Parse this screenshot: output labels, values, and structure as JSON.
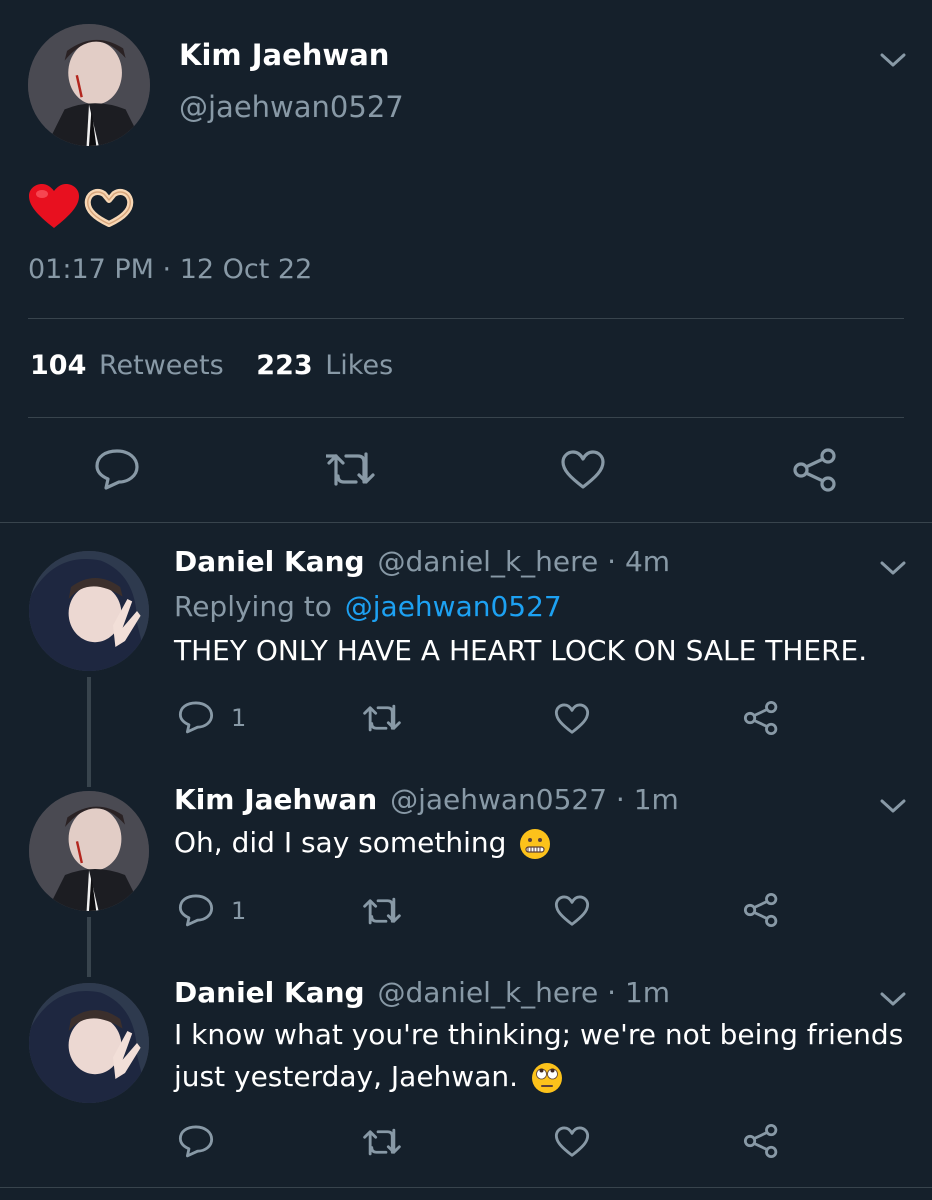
{
  "main_tweet": {
    "author_name": "Kim Jaehwan",
    "author_handle": "@jaehwan0527",
    "timestamp": "01:17 PM · 12 Oct 22",
    "stats": {
      "retweets_count": "104",
      "retweets_label": "Retweets",
      "likes_count": "223",
      "likes_label": "Likes"
    }
  },
  "replies": [
    {
      "author_name": "Daniel Kang",
      "meta": "@daniel_k_here · 4m",
      "replying_to_label": "Replying to",
      "replying_to_handle": "@jaehwan0527",
      "text": "THEY ONLY HAVE A HEART LOCK ON SALE THERE.",
      "reply_count": "1"
    },
    {
      "author_name": "Kim Jaehwan",
      "meta": "@jaehwan0527 · 1m",
      "text": "Oh, did I say something",
      "reply_count": "1"
    },
    {
      "author_name": "Daniel Kang",
      "meta": "@daniel_k_here · 1m",
      "text_line1": "I know what you're thinking; we're not being friends",
      "text_line2": "just yesterday, Jaehwan.",
      "reply_count": ""
    }
  ],
  "colors": {
    "background": "#15202b",
    "muted": "#8899a6",
    "link": "#1da1f2",
    "divider": "#38444d"
  },
  "icons": [
    "chevron-down-icon",
    "reply-icon",
    "retweet-icon",
    "like-icon",
    "share-icon",
    "heart-emoji",
    "heart-hands-emoji",
    "zipper-mouth-emoji",
    "eye-roll-emoji"
  ]
}
